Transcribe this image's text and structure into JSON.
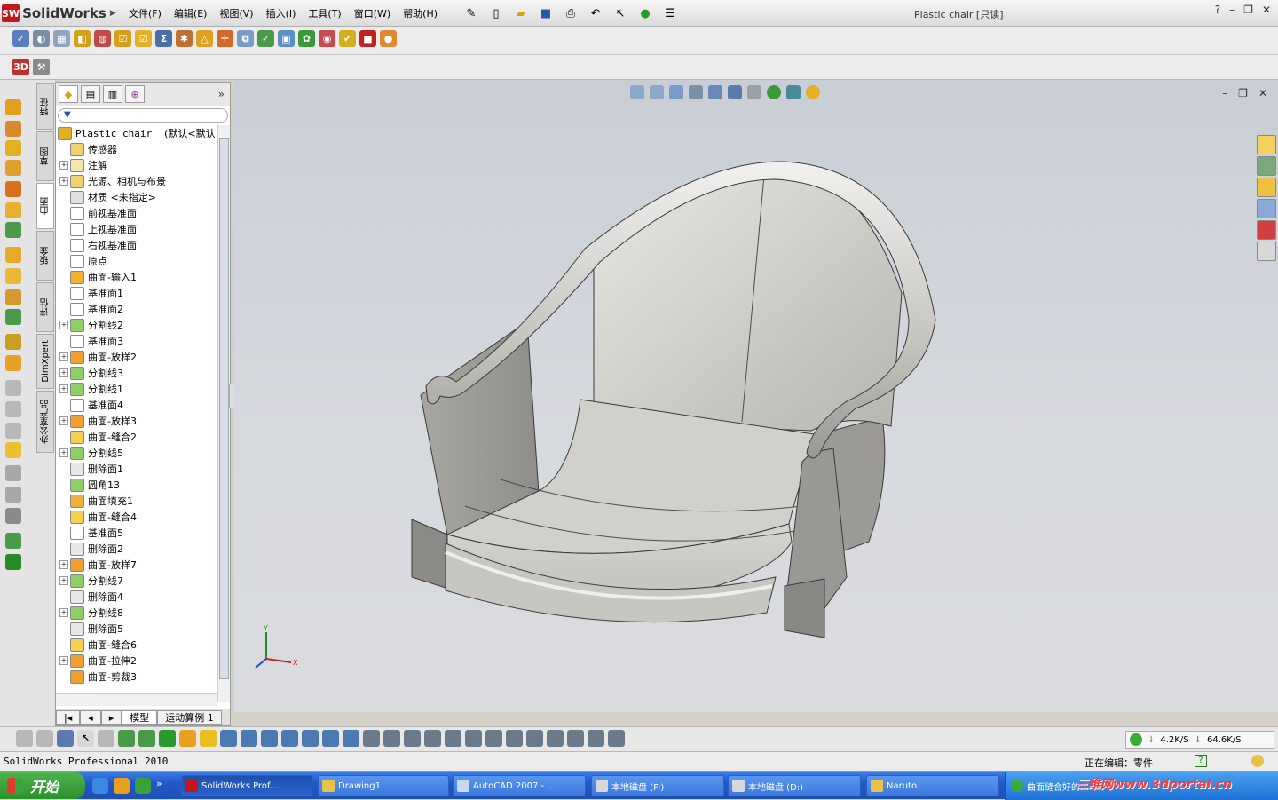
{
  "app": {
    "logo_text": "SolidWorks",
    "logo_badge": "SW",
    "document_title": "Plastic chair [只读]",
    "menu": [
      "文件(F)",
      "编辑(E)",
      "视图(V)",
      "插入(I)",
      "工具(T)",
      "窗口(W)",
      "帮助(H)"
    ]
  },
  "colors": {
    "brand_red": "#c0181d",
    "viewport_top": "#c9ced6",
    "viewport_bottom": "#dadcdf",
    "chair_surface": "#c9c7c2",
    "selection_blue": "#2a55a8"
  },
  "vertical_tabs": [
    "特征",
    "草图",
    "曲面",
    "钣金",
    "评估",
    "DimXpert",
    "办公室产品"
  ],
  "feature_tree": {
    "root_name": "Plastic chair",
    "root_config": "(默认<默认",
    "items": [
      {
        "label": "传感器",
        "icon": "sensor-icon",
        "expandable": false
      },
      {
        "label": "注解",
        "icon": "annotation-icon",
        "expandable": true
      },
      {
        "label": "光源、相机与布景",
        "icon": "lights-icon",
        "expandable": true
      },
      {
        "label": "材质 <未指定>",
        "icon": "material-icon",
        "expandable": false
      },
      {
        "label": "前视基准面",
        "icon": "plane-icon",
        "expandable": false
      },
      {
        "label": "上视基准面",
        "icon": "plane-icon",
        "expandable": false
      },
      {
        "label": "右视基准面",
        "icon": "plane-icon",
        "expandable": false
      },
      {
        "label": "原点",
        "icon": "origin-icon",
        "expandable": false
      },
      {
        "label": "曲面-输入1",
        "icon": "surface-import-icon",
        "expandable": false
      },
      {
        "label": "基准面1",
        "icon": "plane-icon",
        "expandable": false
      },
      {
        "label": "基准面2",
        "icon": "plane-icon",
        "expandable": false
      },
      {
        "label": "分割线2",
        "icon": "split-line-icon",
        "expandable": true
      },
      {
        "label": "基准面3",
        "icon": "plane-icon",
        "expandable": false
      },
      {
        "label": "曲面-放样2",
        "icon": "loft-icon",
        "expandable": true
      },
      {
        "label": "分割线3",
        "icon": "split-line-icon",
        "expandable": true
      },
      {
        "label": "分割线1",
        "icon": "split-line-icon",
        "expandable": true
      },
      {
        "label": "基准面4",
        "icon": "plane-icon",
        "expandable": false
      },
      {
        "label": "曲面-放样3",
        "icon": "loft-icon",
        "expandable": true
      },
      {
        "label": "曲面-缝合2",
        "icon": "knit-icon",
        "expandable": false
      },
      {
        "label": "分割线5",
        "icon": "split-line-icon",
        "expandable": true
      },
      {
        "label": "删除面1",
        "icon": "delete-face-icon",
        "expandable": false
      },
      {
        "label": "圆角13",
        "icon": "fillet-icon",
        "expandable": false
      },
      {
        "label": "曲面填充1",
        "icon": "fill-icon",
        "expandable": false
      },
      {
        "label": "曲面-缝合4",
        "icon": "knit-icon",
        "expandable": false
      },
      {
        "label": "基准面5",
        "icon": "plane-icon",
        "expandable": false
      },
      {
        "label": "删除面2",
        "icon": "delete-face-icon",
        "expandable": false
      },
      {
        "label": "曲面-放样7",
        "icon": "loft-icon",
        "expandable": true
      },
      {
        "label": "分割线7",
        "icon": "split-line-icon",
        "expandable": true
      },
      {
        "label": "删除面4",
        "icon": "delete-face-icon",
        "expandable": false
      },
      {
        "label": "分割线8",
        "icon": "split-line-icon",
        "expandable": true
      },
      {
        "label": "删除面5",
        "icon": "delete-face-icon",
        "expandable": false
      },
      {
        "label": "曲面-缝合6",
        "icon": "knit-icon",
        "expandable": false
      },
      {
        "label": "曲面-拉伸2",
        "icon": "extrude-icon",
        "expandable": true
      },
      {
        "label": "曲面-剪裁3",
        "icon": "trim-icon",
        "expandable": false
      }
    ],
    "bottom_tabs": [
      "模型",
      "运动算例 1"
    ]
  },
  "status": {
    "product": "SolidWorks Professional 2010",
    "editing": "正在编辑：零件",
    "help_glyph": "?"
  },
  "network": {
    "upload": "4.2K/S",
    "download": "64.6K/S"
  },
  "taskbar": {
    "start_label": "开始",
    "tasks": [
      {
        "label": "SolidWorks Prof...",
        "icon_color": "#c0181d",
        "active": true
      },
      {
        "label": "Drawing1",
        "icon_color": "#e8c24a",
        "active": false
      },
      {
        "label": "AutoCAD 2007 - ...",
        "icon_color": "#c8d8f0",
        "active": false
      },
      {
        "label": "本地磁盘 (F:)",
        "icon_color": "#d8d8d8",
        "active": false
      },
      {
        "label": "本地磁盘 (D:)",
        "icon_color": "#d8d8d8",
        "active": false
      },
      {
        "label": "Naruto",
        "icon_color": "#e8c24a",
        "active": false
      }
    ],
    "tray_item": "曲面缝合好的...",
    "watermark": "三维网www.3dportal.cn"
  },
  "triad": {
    "x": "X",
    "y": "Y"
  }
}
